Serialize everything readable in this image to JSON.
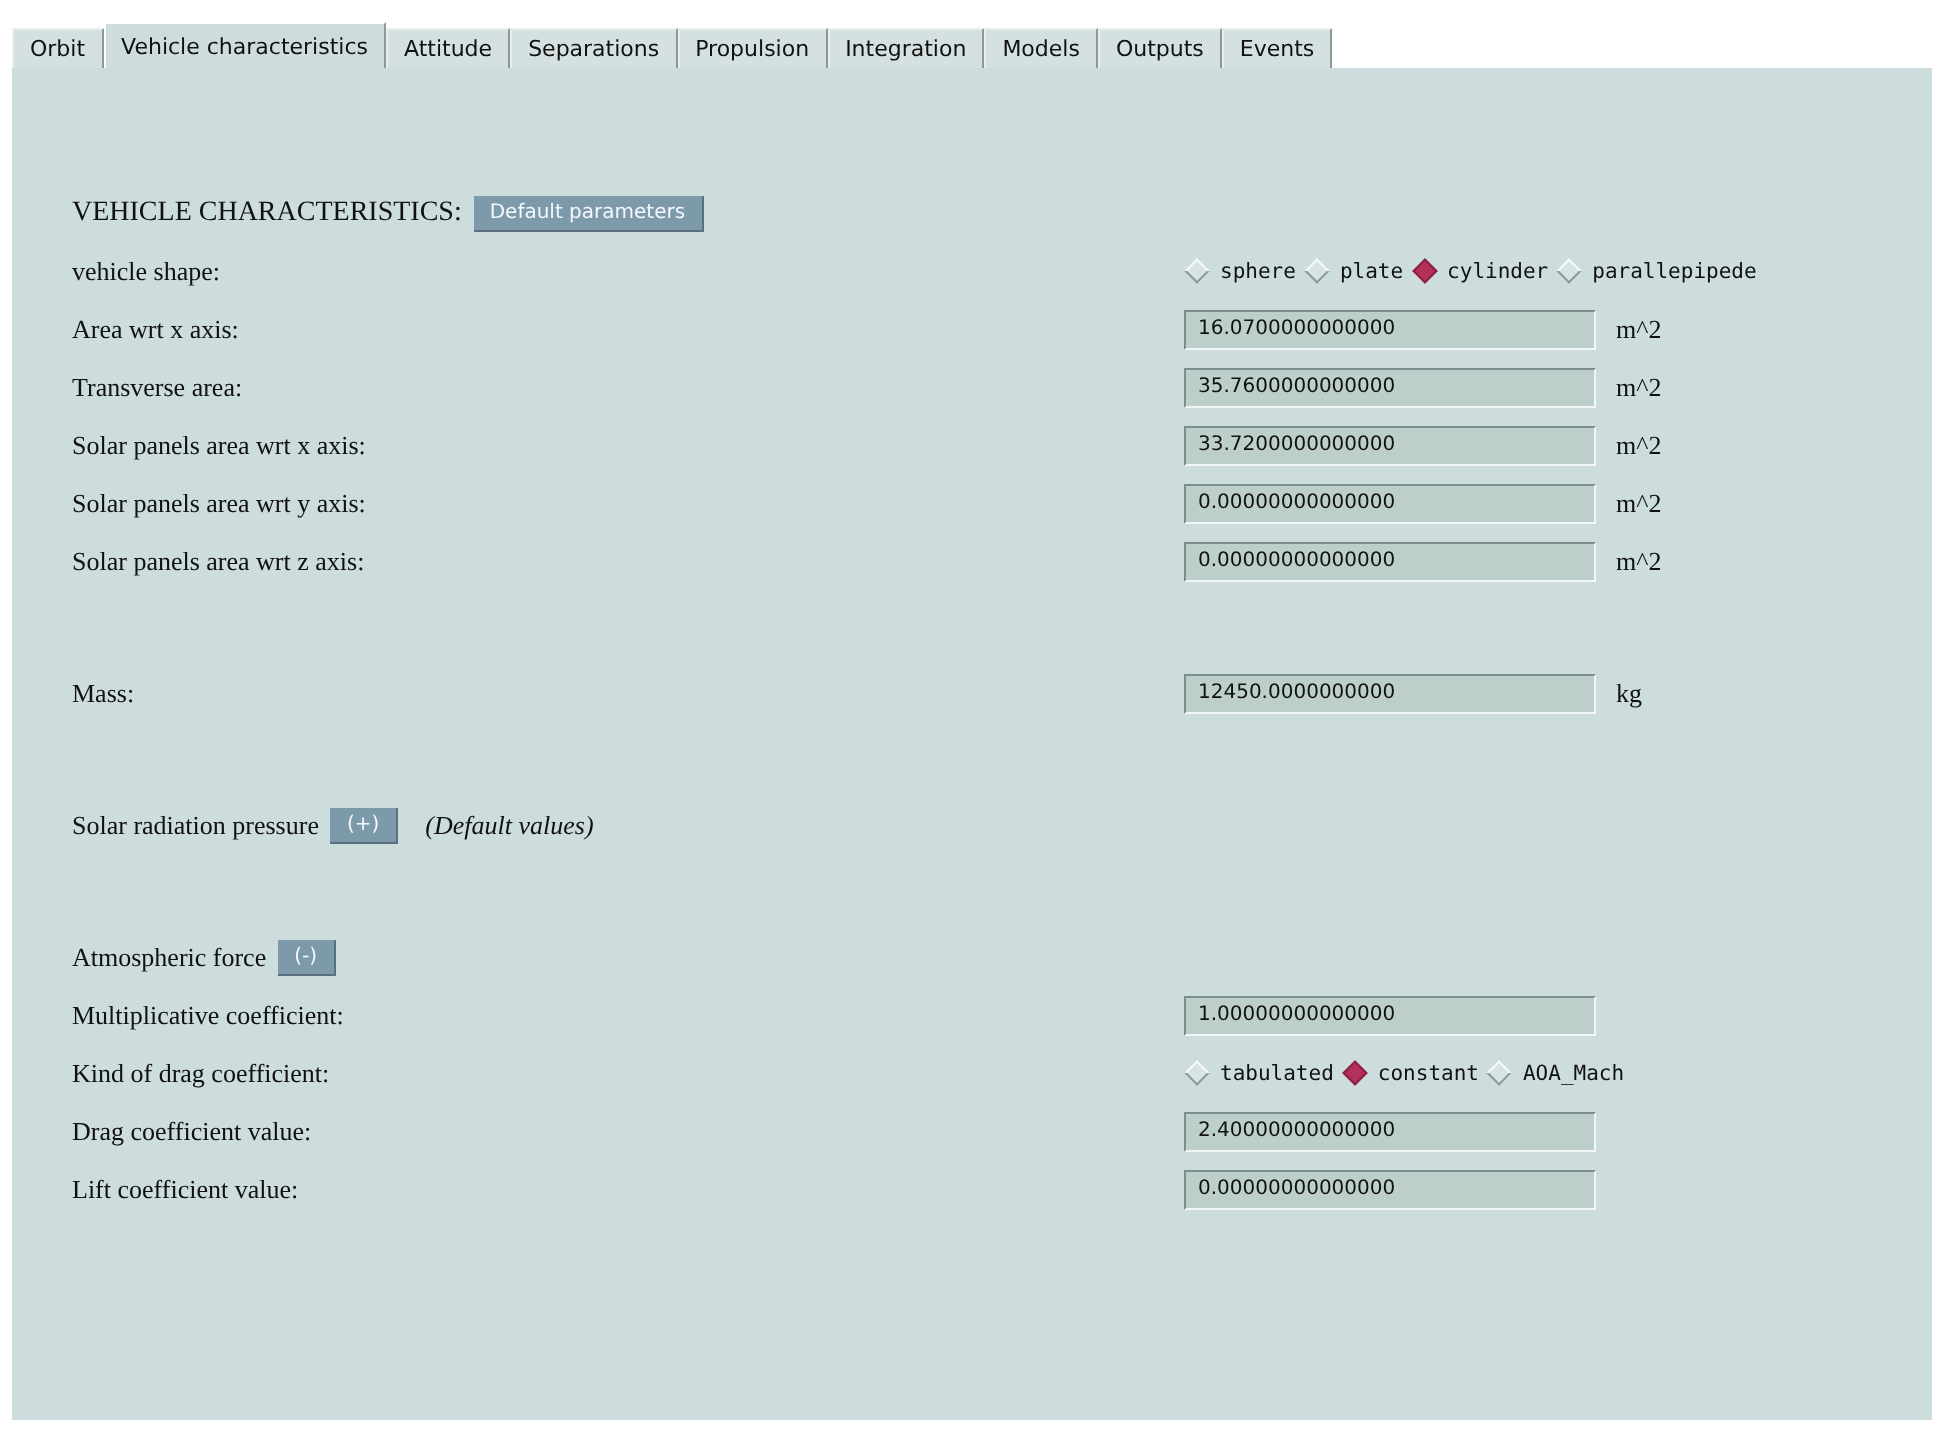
{
  "tabs": [
    {
      "label": "Orbit",
      "selected": false
    },
    {
      "label": "Vehicle characteristics",
      "selected": true
    },
    {
      "label": "Attitude",
      "selected": false
    },
    {
      "label": "Separations",
      "selected": false
    },
    {
      "label": "Propulsion",
      "selected": false
    },
    {
      "label": "Integration",
      "selected": false
    },
    {
      "label": "Models",
      "selected": false
    },
    {
      "label": "Outputs",
      "selected": false
    },
    {
      "label": "Events",
      "selected": false
    }
  ],
  "groups": [
    [
      {
        "kind": "header",
        "label": "VEHICLE CHARACTERISTICS:",
        "button": "Default parameters"
      },
      {
        "kind": "radio",
        "label": "vehicle shape:",
        "options": [
          {
            "label": "sphere",
            "selected": false
          },
          {
            "label": "plate",
            "selected": false
          },
          {
            "label": "cylinder",
            "selected": true
          },
          {
            "label": "parallepipede",
            "selected": false
          }
        ]
      },
      {
        "kind": "field",
        "label": "Area wrt x axis:",
        "value": "16.0700000000000",
        "unit": "m^2"
      },
      {
        "kind": "field",
        "label": "Transverse area:",
        "value": "35.7600000000000",
        "unit": "m^2"
      },
      {
        "kind": "field",
        "label": "Solar panels area wrt x axis:",
        "value": "33.7200000000000",
        "unit": "m^2"
      },
      {
        "kind": "field",
        "label": "Solar panels area wrt y axis:",
        "value": "0.00000000000000",
        "unit": "m^2"
      },
      {
        "kind": "field",
        "label": "Solar panels area wrt z axis:",
        "value": "0.00000000000000",
        "unit": "m^2"
      }
    ],
    [
      {
        "kind": "field",
        "label": "Mass:",
        "value": "12450.0000000000",
        "unit": "kg"
      }
    ],
    [
      {
        "kind": "toggle",
        "label": "Solar radiation pressure",
        "button": "(+)",
        "note": "(Default values)"
      }
    ],
    [
      {
        "kind": "toggle",
        "label": "Atmospheric force",
        "button": "(-)"
      },
      {
        "kind": "field",
        "label": "Multiplicative coefficient:",
        "value": "1.00000000000000"
      },
      {
        "kind": "radio",
        "label": "Kind of drag coefficient:",
        "options": [
          {
            "label": "tabulated",
            "selected": false
          },
          {
            "label": "constant",
            "selected": true
          },
          {
            "label": "AOA_Mach",
            "selected": false
          }
        ]
      },
      {
        "kind": "field",
        "label": "Drag coefficient value:",
        "value": "2.40000000000000"
      },
      {
        "kind": "field",
        "label": "Lift coefficient value:",
        "value": "0.00000000000000"
      }
    ]
  ]
}
